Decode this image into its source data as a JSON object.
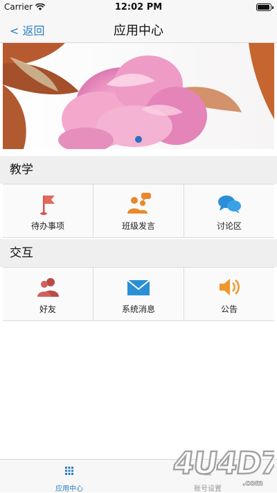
{
  "status_bar": {
    "carrier": "Carrier",
    "time": "12:02 PM",
    "battery_level": 0.95
  },
  "nav": {
    "back_label": "< 返回",
    "title": "应用中心"
  },
  "banner": {
    "page_count": 1,
    "current_page": 1
  },
  "sections": [
    {
      "title": "教学",
      "items": [
        {
          "label": "待办事项",
          "icon": "flag-icon",
          "color": "#d9534f"
        },
        {
          "label": "班级发言",
          "icon": "people-chat-icon",
          "color": "#e8892b"
        },
        {
          "label": "讨论区",
          "icon": "chat-bubbles-icon",
          "color": "#2a8fd6"
        }
      ]
    },
    {
      "title": "交互",
      "items": [
        {
          "label": "好友",
          "icon": "friends-icon",
          "color": "#c0504d"
        },
        {
          "label": "系统消息",
          "icon": "envelope-icon",
          "color": "#2a8fd6"
        },
        {
          "label": "公告",
          "icon": "speaker-icon",
          "color": "#f0962a"
        }
      ]
    }
  ],
  "tabbar": {
    "items": [
      {
        "label": "应用中心",
        "icon": "grid-icon",
        "active": true
      },
      {
        "label": "账号设置",
        "icon": "account-icon",
        "active": false
      }
    ]
  },
  "watermark": {
    "text": "4U4D7.com"
  },
  "colors": {
    "accent": "#2a7fc0",
    "background": "#efefef"
  }
}
